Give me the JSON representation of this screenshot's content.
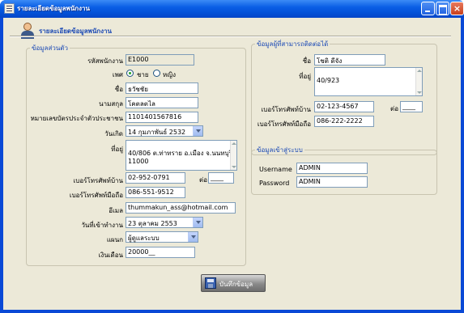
{
  "window": {
    "title": "รายละเอียดข้อมูลพนักงาน"
  },
  "header": {
    "title": "รายละเอียดข้อมูลพนักงาน"
  },
  "personal": {
    "legend": "ข้อมูลส่วนตัว",
    "employee_id_label": "รหัสพนักงาน",
    "employee_id": "E1000",
    "gender_label": "เพศ",
    "gender_male": "ชาย",
    "gender_female": "หญิง",
    "gender_selected": "male",
    "name_label": "ชื่อ",
    "name": "ธวัชชัย",
    "surname_label": "นามสกุล",
    "surname": "โคตลตไล",
    "idcard_label": "หมายเลขบัตรประจำตัวประชาชน",
    "idcard": "1101401567816",
    "birthdate_label": "วันเกิด",
    "birthdate": "14 กุมภาพันธ์   2532",
    "address_label": "ที่อยู่",
    "address": "40/806 ต.ท่าทราย อ.เมือง จ.นนทบุรี\n11000",
    "home_phone_label": "เบอร์โทรศัพท์บ้าน",
    "home_phone": "02-952-0791",
    "ext_label": "ต่อ",
    "ext": "____",
    "mobile_label": "เบอร์โทรศัพท์มือถือ",
    "mobile": "086-551-9512",
    "email_label": "อีเมล",
    "email": "thummakun_ass@hotmail.com",
    "start_date_label": "วันที่เข้าทำงาน",
    "start_date": "23   ตุลาคม      2553",
    "department_label": "แผนก",
    "department": "ผู้ดูแลระบบ",
    "salary_label": "เงินเดือน",
    "salary": "20000__"
  },
  "contact": {
    "legend": "ข้อมูลผู้ที่สามารถติดต่อได้",
    "name_label": "ชื่อ",
    "name": "โชติ ดีจัง",
    "address_label": "ที่อยู่",
    "address": "40/923",
    "home_phone_label": "เบอร์โทรศัพท์บ้าน",
    "home_phone": "02-123-4567",
    "ext_label": "ต่อ",
    "ext": "____",
    "mobile_label": "เบอร์โทรศัพท์มือถือ",
    "mobile": "086-222-2222"
  },
  "login": {
    "legend": "ข้อมูลเข้าสู่ระบบ",
    "username_label": "Username",
    "username": "ADMIN",
    "password_label": "Password",
    "password": "ADMIN"
  },
  "actions": {
    "save_label": "บันทึกข้อมูล"
  }
}
